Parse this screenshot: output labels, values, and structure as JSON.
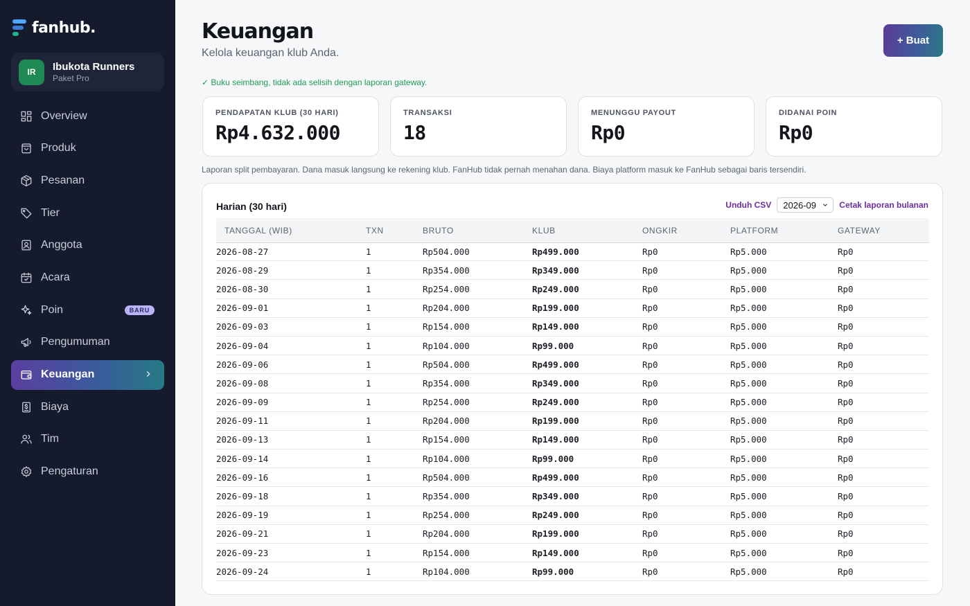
{
  "brand": {
    "name": "fanhub."
  },
  "club": {
    "initials": "IR",
    "name": "Ibukota Runners",
    "plan": "Paket Pro"
  },
  "nav": {
    "items": [
      {
        "label": "Overview",
        "icon": "grid-icon"
      },
      {
        "label": "Produk",
        "icon": "bag-icon"
      },
      {
        "label": "Pesanan",
        "icon": "box-icon"
      },
      {
        "label": "Tier",
        "icon": "tag-icon"
      },
      {
        "label": "Anggota",
        "icon": "id-card-icon"
      },
      {
        "label": "Acara",
        "icon": "calendar-icon"
      },
      {
        "label": "Poin",
        "icon": "sparkle-icon",
        "badge": "BARU"
      },
      {
        "label": "Pengumuman",
        "icon": "megaphone-icon"
      },
      {
        "label": "Keuangan",
        "icon": "wallet-icon",
        "active": true
      },
      {
        "label": "Biaya",
        "icon": "receipt-icon"
      },
      {
        "label": "Tim",
        "icon": "users-icon"
      },
      {
        "label": "Pengaturan",
        "icon": "gear-icon"
      }
    ]
  },
  "header": {
    "title": "Keuangan",
    "subtitle": "Kelola keuangan klub Anda.",
    "create_label": "+ Buat"
  },
  "balance_note": "✓ Buku seimbang, tidak ada selisih dengan laporan gateway.",
  "stats": [
    {
      "label": "PENDAPATAN KLUB (30 HARI)",
      "value": "Rp4.632.000"
    },
    {
      "label": "TRANSAKSI",
      "value": "18"
    },
    {
      "label": "MENUNGGU PAYOUT",
      "value": "Rp0"
    },
    {
      "label": "DIDANAI POIN",
      "value": "Rp0"
    }
  ],
  "split_note": "Laporan split pembayaran. Dana masuk langsung ke rekening klub. FanHub tidak pernah menahan dana. Biaya platform masuk ke FanHub sebagai baris tersendiri.",
  "daily": {
    "title": "Harian (30 hari)",
    "download_csv": "Unduh CSV",
    "month": "2026-09",
    "print_monthly": "Cetak laporan bulanan",
    "columns": [
      "TANGGAL (WIB)",
      "TXN",
      "BRUTO",
      "KLUB",
      "ONGKIR",
      "PLATFORM",
      "GATEWAY"
    ],
    "rows": [
      [
        "2026-08-27",
        "1",
        "Rp504.000",
        "Rp499.000",
        "Rp0",
        "Rp5.000",
        "Rp0"
      ],
      [
        "2026-08-29",
        "1",
        "Rp354.000",
        "Rp349.000",
        "Rp0",
        "Rp5.000",
        "Rp0"
      ],
      [
        "2026-08-30",
        "1",
        "Rp254.000",
        "Rp249.000",
        "Rp0",
        "Rp5.000",
        "Rp0"
      ],
      [
        "2026-09-01",
        "1",
        "Rp204.000",
        "Rp199.000",
        "Rp0",
        "Rp5.000",
        "Rp0"
      ],
      [
        "2026-09-03",
        "1",
        "Rp154.000",
        "Rp149.000",
        "Rp0",
        "Rp5.000",
        "Rp0"
      ],
      [
        "2026-09-04",
        "1",
        "Rp104.000",
        "Rp99.000",
        "Rp0",
        "Rp5.000",
        "Rp0"
      ],
      [
        "2026-09-06",
        "1",
        "Rp504.000",
        "Rp499.000",
        "Rp0",
        "Rp5.000",
        "Rp0"
      ],
      [
        "2026-09-08",
        "1",
        "Rp354.000",
        "Rp349.000",
        "Rp0",
        "Rp5.000",
        "Rp0"
      ],
      [
        "2026-09-09",
        "1",
        "Rp254.000",
        "Rp249.000",
        "Rp0",
        "Rp5.000",
        "Rp0"
      ],
      [
        "2026-09-11",
        "1",
        "Rp204.000",
        "Rp199.000",
        "Rp0",
        "Rp5.000",
        "Rp0"
      ],
      [
        "2026-09-13",
        "1",
        "Rp154.000",
        "Rp149.000",
        "Rp0",
        "Rp5.000",
        "Rp0"
      ],
      [
        "2026-09-14",
        "1",
        "Rp104.000",
        "Rp99.000",
        "Rp0",
        "Rp5.000",
        "Rp0"
      ],
      [
        "2026-09-16",
        "1",
        "Rp504.000",
        "Rp499.000",
        "Rp0",
        "Rp5.000",
        "Rp0"
      ],
      [
        "2026-09-18",
        "1",
        "Rp354.000",
        "Rp349.000",
        "Rp0",
        "Rp5.000",
        "Rp0"
      ],
      [
        "2026-09-19",
        "1",
        "Rp254.000",
        "Rp249.000",
        "Rp0",
        "Rp5.000",
        "Rp0"
      ],
      [
        "2026-09-21",
        "1",
        "Rp204.000",
        "Rp199.000",
        "Rp0",
        "Rp5.000",
        "Rp0"
      ],
      [
        "2026-09-23",
        "1",
        "Rp154.000",
        "Rp149.000",
        "Rp0",
        "Rp5.000",
        "Rp0"
      ],
      [
        "2026-09-24",
        "1",
        "Rp104.000",
        "Rp99.000",
        "Rp0",
        "Rp5.000",
        "Rp0"
      ]
    ]
  }
}
